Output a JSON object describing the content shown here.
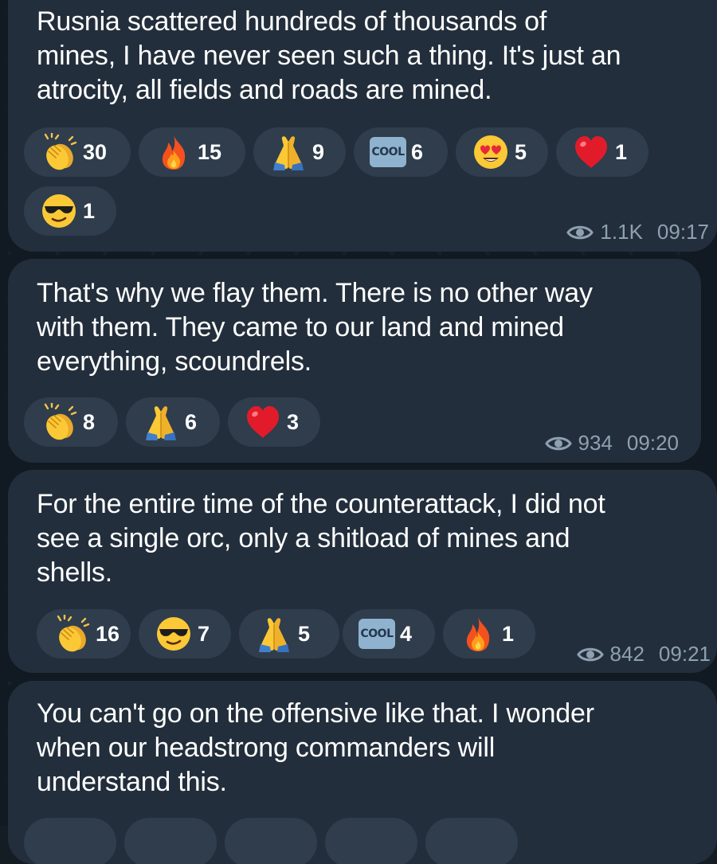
{
  "messages": [
    {
      "text": "Rusnia scattered hundreds of thousands of\nmines, I have never seen such a thing. It's just an\natrocity, all fields and roads are mined.",
      "reactions": [
        {
          "icon": "clapping-hands-icon",
          "count": "30"
        },
        {
          "icon": "fire-icon",
          "count": "15"
        },
        {
          "icon": "folded-hands-icon",
          "count": "9"
        },
        {
          "icon": "cool-button-icon",
          "label": "COOL",
          "count": "6"
        },
        {
          "icon": "heart-eyes-icon",
          "count": "5"
        },
        {
          "icon": "red-heart-icon",
          "count": "1"
        },
        {
          "icon": "sunglasses-face-icon",
          "count": "1"
        }
      ],
      "views": "1.1K",
      "time": "09:17"
    },
    {
      "text": "That's why we flay them. There is no other way\nwith them. They came to our land and mined\neverything, scoundrels.",
      "reactions": [
        {
          "icon": "clapping-hands-icon",
          "count": "8"
        },
        {
          "icon": "folded-hands-icon",
          "count": "6"
        },
        {
          "icon": "red-heart-icon",
          "count": "3"
        }
      ],
      "views": "934",
      "time": "09:20"
    },
    {
      "text": "For the entire time of the counterattack, I did not\nsee a single orc, only a shitload of mines and\nshells.",
      "reactions": [
        {
          "icon": "clapping-hands-icon",
          "count": "16"
        },
        {
          "icon": "sunglasses-face-icon",
          "count": "7"
        },
        {
          "icon": "folded-hands-icon",
          "count": "5"
        },
        {
          "icon": "cool-button-icon",
          "label": "COOL",
          "count": "4"
        },
        {
          "icon": "fire-icon",
          "count": "1"
        }
      ],
      "views": "842",
      "time": "09:21"
    },
    {
      "text": "You can't go on the offensive like that. I wonder\nwhen our headstrong commanders will\nunderstand this."
    }
  ],
  "colors": {
    "bubble": "#222e3b",
    "reaction_pill": "#2f3d4d",
    "meta_text": "#8fa0b0",
    "background": "#111922"
  }
}
